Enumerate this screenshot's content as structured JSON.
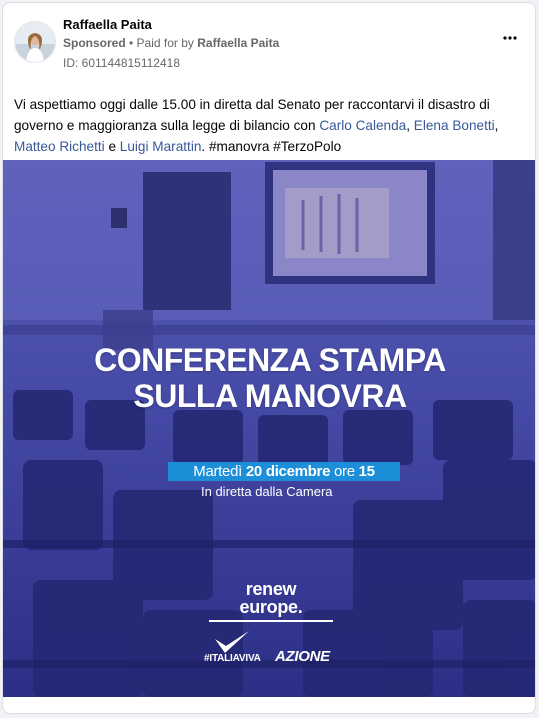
{
  "post": {
    "page_name": "Raffaella Paita",
    "sponsored_label": "Sponsored",
    "separator": " • ",
    "paid_for_prefix": "Paid for by ",
    "paid_for_name": "Raffaella Paita",
    "ad_id": "ID: 601144815112418",
    "more_icon": "more-horizontal-icon",
    "text_before": "Vi aspettiamo oggi dalle 15.00 in diretta dal Senato per raccontarvi il disastro di governo e maggioranza sulla legge di bilancio con ",
    "mention_1": "Carlo Calenda",
    "comma_1": ", ",
    "mention_2": "Elena Bonetti",
    "comma_2": ",",
    "mention_3": "Matteo Richetti",
    "conj": " e ",
    "mention_4": "Luigi Marattin",
    "text_after": ". #manovra #TerzoPolo",
    "link_color": "#385898"
  },
  "creative": {
    "headline_line1": "CONFERENZA STAMPA",
    "headline_line2": "SULLA MANOVRA",
    "date_day": "Martedì ",
    "date_bold": "20 dicembre",
    "date_ore": " ore ",
    "date_hour": "15",
    "subline": "In diretta dalla Camera",
    "renew_line1": "renew",
    "renew_line2": "europe.",
    "iv_label": "#ITALIAVIVA",
    "azione_label": "AZIONE",
    "overlay_color": "#3d3fa0",
    "pill_color": "#1c8fd8"
  }
}
